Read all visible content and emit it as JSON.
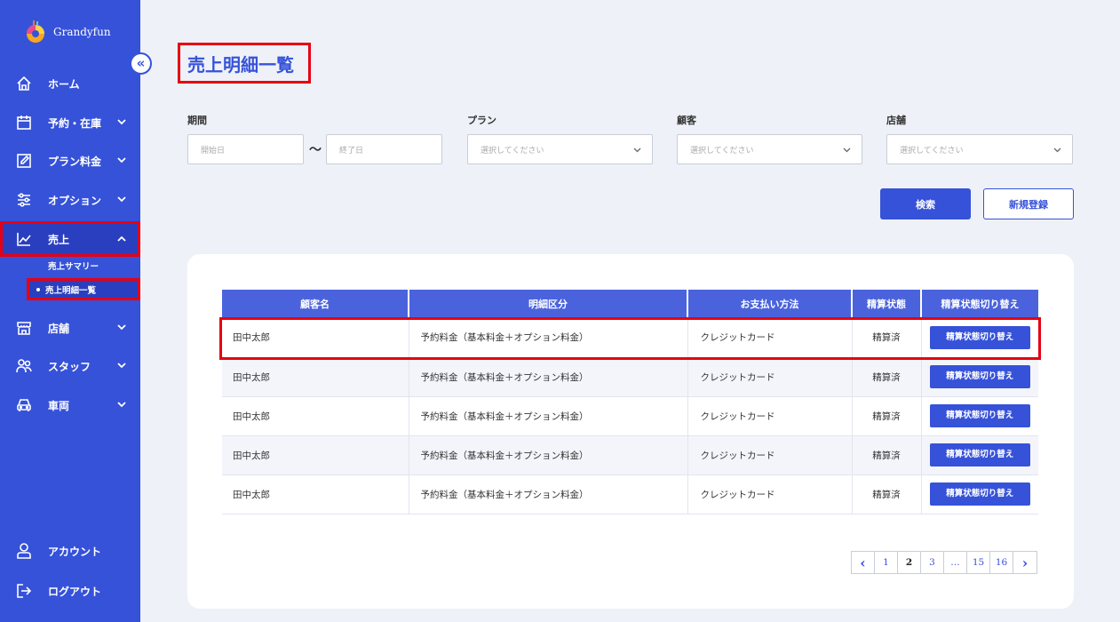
{
  "app": {
    "name": "Grandyfun"
  },
  "sidebar": {
    "collapse_glyph": "«",
    "items": [
      {
        "label": "ホーム",
        "icon": "home-icon"
      },
      {
        "label": "予約・在庫",
        "icon": "calendar-icon"
      },
      {
        "label": "プラン料金",
        "icon": "edit-icon"
      },
      {
        "label": "オプション",
        "icon": "sliders-icon"
      },
      {
        "label": "売上",
        "icon": "chart-line-icon"
      },
      {
        "label": "店舗",
        "icon": "store-icon"
      },
      {
        "label": "スタッフ",
        "icon": "staff-icon"
      },
      {
        "label": "車両",
        "icon": "car-icon"
      }
    ],
    "sub_items": [
      {
        "label": "売上サマリー"
      },
      {
        "label": "売上明細一覧"
      }
    ],
    "bottom": [
      {
        "label": "アカウント",
        "icon": "user-icon"
      },
      {
        "label": "ログアウト",
        "icon": "logout-icon"
      }
    ]
  },
  "page": {
    "title": "売上明細一覧"
  },
  "filters": {
    "period_label": "期間",
    "start_placeholder": "開始日",
    "end_placeholder": "終了日",
    "range_sep": "～",
    "plan_label": "プラン",
    "plan_value": "選択してください",
    "customer_label": "顧客",
    "customer_value": "選択してください",
    "store_label": "店舗",
    "store_value": "選択してください"
  },
  "actions": {
    "search": "検索",
    "new": "新規登録"
  },
  "table": {
    "headers": [
      "顧客名",
      "明細区分",
      "お支払い方法",
      "精算状態",
      "精算状態切り替え"
    ],
    "rows": [
      {
        "name": "田中太郎",
        "type": "予約料金（基本料金＋オプション料金）",
        "payment": "クレジットカード",
        "status": "精算済",
        "button": "精算状態切り替え"
      },
      {
        "name": "田中太郎",
        "type": "予約料金（基本料金＋オプション料金）",
        "payment": "クレジットカード",
        "status": "精算済",
        "button": "精算状態切り替え"
      },
      {
        "name": "田中太郎",
        "type": "予約料金（基本料金＋オプション料金）",
        "payment": "クレジットカード",
        "status": "精算済",
        "button": "精算状態切り替え"
      },
      {
        "name": "田中太郎",
        "type": "予約料金（基本料金＋オプション料金）",
        "payment": "クレジットカード",
        "status": "精算済",
        "button": "精算状態切り替え"
      },
      {
        "name": "田中太郎",
        "type": "予約料金（基本料金＋オプション料金）",
        "payment": "クレジットカード",
        "status": "精算済",
        "button": "精算状態切り替え"
      }
    ]
  },
  "pagination": {
    "prev": "‹",
    "pages": [
      "1",
      "2",
      "3",
      "…",
      "15",
      "16"
    ],
    "current": "2",
    "next": "›"
  },
  "colors": {
    "sidebar": "#3652d9",
    "accent": "#3652d9",
    "highlight": "#e60012",
    "background": "#eef1f8"
  }
}
